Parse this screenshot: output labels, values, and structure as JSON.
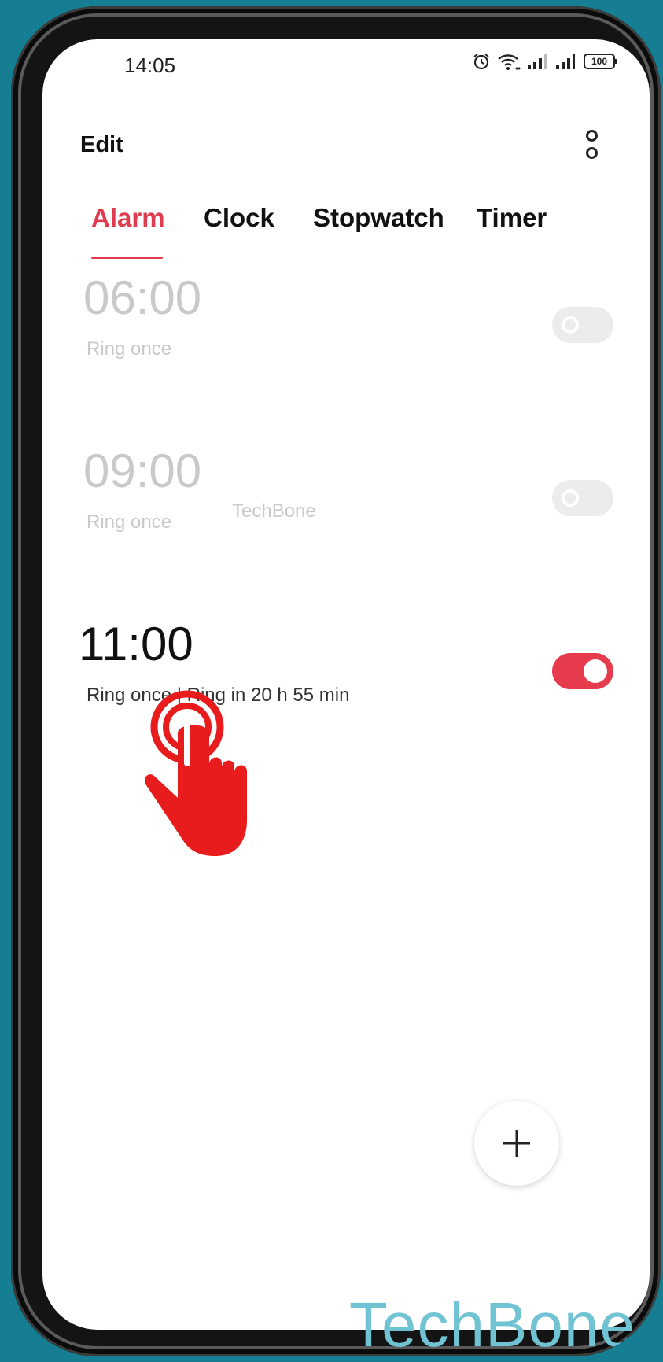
{
  "status_bar": {
    "time": "14:05",
    "battery": "100"
  },
  "header": {
    "edit_label": "Edit"
  },
  "tabs": [
    {
      "label": "Alarm",
      "active": true
    },
    {
      "label": "Clock",
      "active": false
    },
    {
      "label": "Stopwatch",
      "active": false
    },
    {
      "label": "Timer",
      "active": false
    }
  ],
  "alarms": [
    {
      "time": "06:00",
      "label": "",
      "repeat": "Ring once",
      "enabled": false
    },
    {
      "time": "09:00",
      "label": "TechBone",
      "repeat": "Ring once",
      "enabled": false
    },
    {
      "time": "11:00",
      "label": "",
      "repeat": "Ring once | Ring in 20 h 55 min",
      "enabled": true
    }
  ],
  "add_button": "+",
  "watermark": "TechBone",
  "colors": {
    "accent": "#e03c4f",
    "background": "#157e92",
    "watermark": "#6fc3d2"
  }
}
